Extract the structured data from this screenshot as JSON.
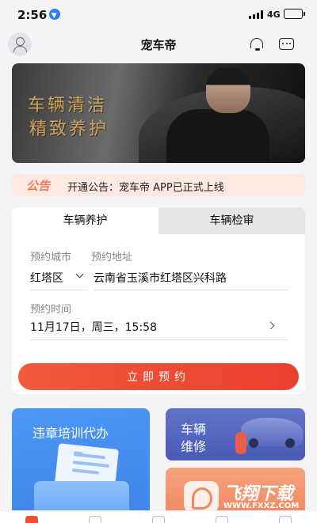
{
  "status_bar": {
    "time": "2:56",
    "network": "4G"
  },
  "header": {
    "title": "宠车帝"
  },
  "banner": {
    "line1": "车辆清洁",
    "line2": "精致养护"
  },
  "notice": {
    "tag": "公告",
    "text": "开通公告：宠车帝 APP已正式上线"
  },
  "booking": {
    "tabs": [
      {
        "label": "车辆养护",
        "active": true
      },
      {
        "label": "车辆检审",
        "active": false
      }
    ],
    "city_label": "预约城市",
    "address_label": "预约地址",
    "city_value": "红塔区",
    "address_value": "云南省玉溪市红塔区兴科路",
    "time_label": "预约时间",
    "time_value": "11月17日，周三，15:58",
    "button_label": "立即预约"
  },
  "services": {
    "training_title": "违章培训代办",
    "repair_line1": "车辆",
    "repair_line2": "维修"
  },
  "watermark": {
    "text": "飞翔下载",
    "url": "WWW.FXXZ.COM"
  },
  "colors": {
    "accent": "#ea4030",
    "notice_bg": "#fde9e2",
    "training_card": "#4b97f4",
    "repair_card": "#5363bc"
  }
}
